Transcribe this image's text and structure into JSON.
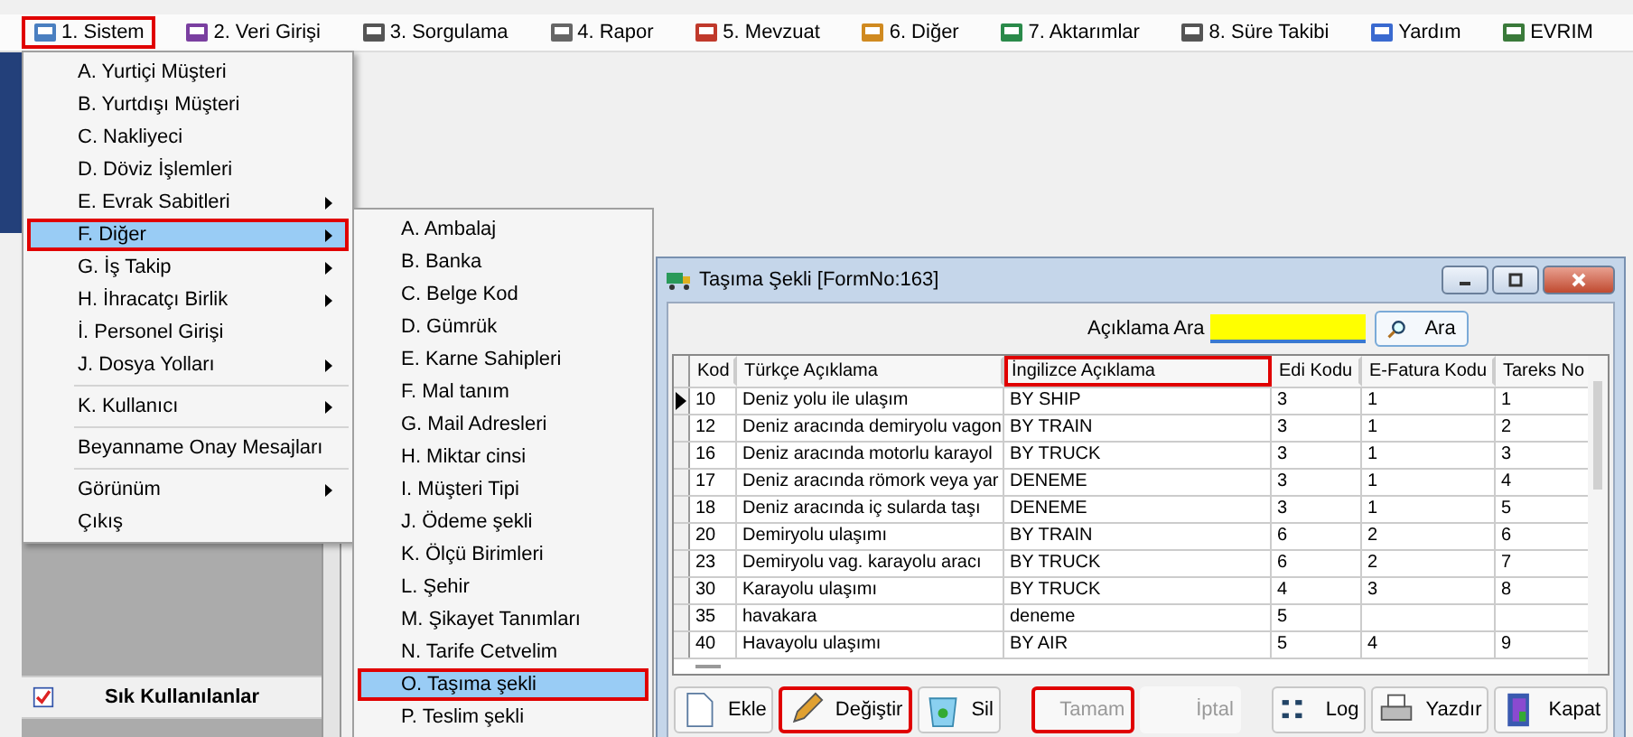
{
  "menubar": [
    {
      "label": "1.  Sistem",
      "highlighted": true
    },
    {
      "label": "2.  Veri Girişi",
      "highlighted": false
    },
    {
      "label": "3.  Sorgulama",
      "highlighted": false
    },
    {
      "label": "4.  Rapor",
      "highlighted": false
    },
    {
      "label": "5.  Mevzuat",
      "highlighted": false
    },
    {
      "label": "6.  Diğer",
      "highlighted": false
    },
    {
      "label": "7.  Aktarımlar",
      "highlighted": false
    },
    {
      "label": "8. Süre Takibi",
      "highlighted": false
    },
    {
      "label": "Yardım",
      "highlighted": false
    },
    {
      "label": "EVRIM",
      "highlighted": false
    }
  ],
  "sistem_menu": [
    {
      "kind": "item",
      "label": "A.  Yurtiçi Müşteri",
      "submenu": false,
      "selected": false,
      "highlighted": false
    },
    {
      "kind": "item",
      "label": "B.  Yurtdışı Müşteri",
      "submenu": false,
      "selected": false,
      "highlighted": false
    },
    {
      "kind": "item",
      "label": "C.  Nakliyeci",
      "submenu": false,
      "selected": false,
      "highlighted": false
    },
    {
      "kind": "item",
      "label": "D.  Döviz İşlemleri",
      "submenu": false,
      "selected": false,
      "highlighted": false
    },
    {
      "kind": "item",
      "label": "E.  Evrak Sabitleri",
      "submenu": true,
      "selected": false,
      "highlighted": false
    },
    {
      "kind": "item",
      "label": "F.  Diğer",
      "submenu": true,
      "selected": true,
      "highlighted": true
    },
    {
      "kind": "item",
      "label": "G.  İş Takip",
      "submenu": true,
      "selected": false,
      "highlighted": false
    },
    {
      "kind": "item",
      "label": "H.  İhracatçı Birlik",
      "submenu": true,
      "selected": false,
      "highlighted": false
    },
    {
      "kind": "item",
      "label": "İ.  Personel Girişi",
      "submenu": false,
      "selected": false,
      "highlighted": false
    },
    {
      "kind": "item",
      "label": "J.  Dosya Yolları",
      "submenu": true,
      "selected": false,
      "highlighted": false
    },
    {
      "kind": "separator"
    },
    {
      "kind": "item",
      "label": "K.  Kullanıcı",
      "submenu": true,
      "selected": false,
      "highlighted": false
    },
    {
      "kind": "separator"
    },
    {
      "kind": "item",
      "label": "Beyanname Onay Mesajları",
      "submenu": false,
      "selected": false,
      "highlighted": false
    },
    {
      "kind": "separator"
    },
    {
      "kind": "item",
      "label": "Görünüm",
      "submenu": true,
      "selected": false,
      "highlighted": false
    },
    {
      "kind": "item",
      "label": "Çıkış",
      "submenu": false,
      "selected": false,
      "highlighted": false
    }
  ],
  "diger_submenu": [
    {
      "label": "A.  Ambalaj",
      "selected": false,
      "highlighted": false
    },
    {
      "label": "B.  Banka",
      "selected": false,
      "highlighted": false
    },
    {
      "label": "C.  Belge Kod",
      "selected": false,
      "highlighted": false
    },
    {
      "label": "D.  Gümrük",
      "selected": false,
      "highlighted": false
    },
    {
      "label": "E.  Karne Sahipleri",
      "selected": false,
      "highlighted": false
    },
    {
      "label": "F.  Mal tanım",
      "selected": false,
      "highlighted": false
    },
    {
      "label": "G.  Mail Adresleri",
      "selected": false,
      "highlighted": false
    },
    {
      "label": "H.  Miktar cinsi",
      "selected": false,
      "highlighted": false
    },
    {
      "label": "I.  Müşteri Tipi",
      "selected": false,
      "highlighted": false
    },
    {
      "label": "J.  Ödeme şekli",
      "selected": false,
      "highlighted": false
    },
    {
      "label": "K.  Ölçü Birimleri",
      "selected": false,
      "highlighted": false
    },
    {
      "label": "L.  Şehir",
      "selected": false,
      "highlighted": false
    },
    {
      "label": "M.  Şikayet Tanımları",
      "selected": false,
      "highlighted": false
    },
    {
      "label": "N.  Tarife Cetvelim",
      "selected": false,
      "highlighted": false
    },
    {
      "label": "O.  Taşıma şekli",
      "selected": true,
      "highlighted": true
    },
    {
      "label": "P.  Teslim şekli",
      "selected": false,
      "highlighted": false
    }
  ],
  "sidebar": {
    "favorites_label": "Sık Kullanılanlar"
  },
  "window": {
    "title": "Taşıma Şekli [FormNo:163]",
    "search": {
      "label": "Açıklama Ara",
      "button": "Ara"
    },
    "table": {
      "columns": [
        {
          "label": "Kod",
          "highlighted": false
        },
        {
          "label": "Türkçe Açıklama",
          "highlighted": false
        },
        {
          "label": "İngilizce Açıklama",
          "highlighted": true
        },
        {
          "label": "Edi Kodu",
          "highlighted": false
        },
        {
          "label": "E-Fatura Kodu",
          "highlighted": false
        },
        {
          "label": "Tareks No",
          "highlighted": false
        }
      ],
      "rows": [
        {
          "current": true,
          "cells": [
            "10",
            "Deniz yolu ile ulaşım",
            "BY SHIP",
            "3",
            "1",
            "1"
          ]
        },
        {
          "current": false,
          "cells": [
            "12",
            "Deniz aracında demiryolu vagon",
            "BY TRAIN",
            "3",
            "1",
            "2"
          ]
        },
        {
          "current": false,
          "cells": [
            "16",
            "Deniz aracında motorlu karayol",
            "BY TRUCK",
            "3",
            "1",
            "3"
          ]
        },
        {
          "current": false,
          "cells": [
            "17",
            "Deniz aracında römork veya yar",
            "DENEME",
            "3",
            "1",
            "4"
          ]
        },
        {
          "current": false,
          "cells": [
            "18",
            "Deniz aracında iç sularda taşı",
            "DENEME",
            "3",
            "1",
            "5"
          ]
        },
        {
          "current": false,
          "cells": [
            "20",
            "Demiryolu ulaşımı",
            "BY TRAIN",
            "6",
            "2",
            "6"
          ]
        },
        {
          "current": false,
          "cells": [
            "23",
            "Demiryolu vag. karayolu aracı",
            "BY TRUCK",
            "6",
            "2",
            "7"
          ]
        },
        {
          "current": false,
          "cells": [
            "30",
            "Karayolu ulaşımı",
            "BY TRUCK",
            "4",
            "3",
            "8"
          ]
        },
        {
          "current": false,
          "cells": [
            "35",
            "havakara",
            "deneme",
            "5",
            null,
            null
          ]
        },
        {
          "current": false,
          "cells": [
            "40",
            "Havayolu ulaşımı",
            "BY AIR",
            "5",
            "4",
            "9"
          ]
        }
      ]
    },
    "buttons": [
      {
        "label": "Ekle",
        "disabled": false,
        "highlighted": false
      },
      {
        "label": "Değiştir",
        "disabled": false,
        "highlighted": true
      },
      {
        "label": "Sil",
        "disabled": false,
        "highlighted": false
      },
      {
        "label": "Tamam",
        "disabled": true,
        "highlighted": true
      },
      {
        "label": "İptal",
        "disabled": true,
        "highlighted": false
      },
      {
        "label": "Log",
        "disabled": false,
        "highlighted": false
      },
      {
        "label": "Yazdır",
        "disabled": false,
        "highlighted": false
      },
      {
        "label": "Kapat",
        "disabled": false,
        "highlighted": false
      }
    ]
  }
}
